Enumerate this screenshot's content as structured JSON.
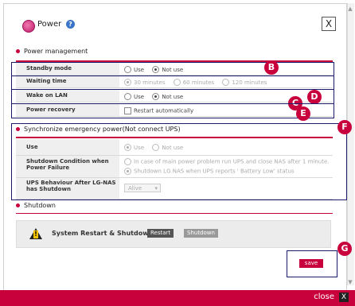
{
  "window": {
    "title": "Power",
    "close_glyph": "X",
    "help_glyph": "?"
  },
  "power_management": {
    "heading": "Power management",
    "rows": [
      {
        "label": "Standby mode",
        "options": [
          "Use",
          "Not use"
        ],
        "selected": "Not use"
      },
      {
        "label": "Waiting time",
        "options": [
          "30 minutes",
          "60 minutes",
          "120 minutes"
        ],
        "selected": "30 minutes"
      },
      {
        "label": "Wake on LAN",
        "options": [
          "Use",
          "Not use"
        ],
        "selected": "Not use"
      },
      {
        "label": "Power recovery",
        "checkbox_label": "Restart automatically",
        "checked": false
      }
    ]
  },
  "ups": {
    "heading": "Synchronize emergency power(Not connect UPS)",
    "use_label": "Use",
    "use_options": [
      "Use",
      "Not use"
    ],
    "use_selected": "Use",
    "shutdown_label": "Shutdown Condition when Power Failure",
    "shutdown_options": [
      "In case of main power problem run UPS and close NAS after 1 minute.",
      "Shutdown LG NAS when UPS reports ' Battery Low' status"
    ],
    "shutdown_selected_index": 1,
    "behaviour_label": "UPS Behaviour After LG-NAS has Shutdown",
    "behaviour_value": "Alive"
  },
  "shutdown": {
    "heading": "Shutdown",
    "text": "System Restart & Shutdown",
    "restart_label": "Restart",
    "shutdown_label": "Shutdown"
  },
  "save_label": "save",
  "footer": {
    "close_label": "close",
    "close_glyph": "X"
  },
  "annotations": [
    "B",
    "C",
    "D",
    "E",
    "F",
    "G"
  ],
  "colors": {
    "accent": "#c8003c",
    "annotation_border": "#1a1a6e"
  }
}
